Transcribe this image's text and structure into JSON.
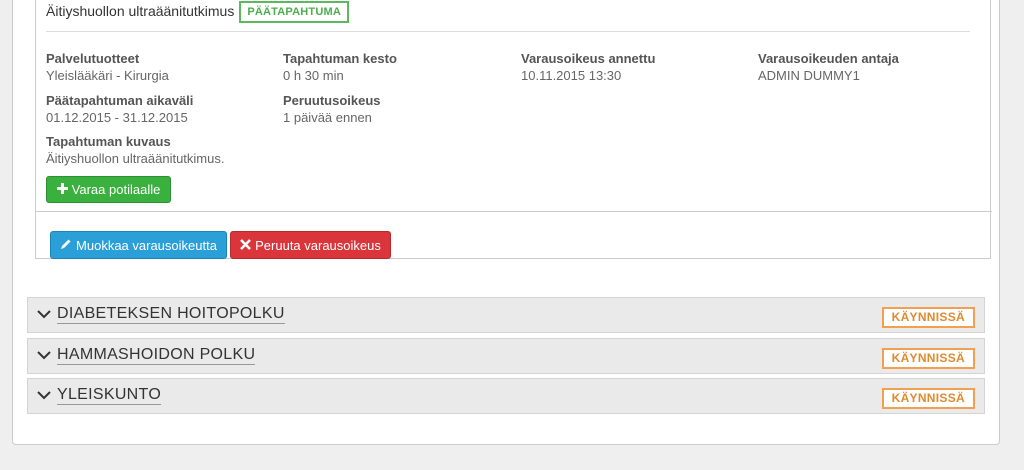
{
  "event": {
    "title": "Äitiyshuollon ultraäänitutkimus",
    "badge": "PÄÄTAPAHTUMA",
    "fields": [
      {
        "label": "Palvelutuotteet",
        "value": "Yleislääkäri - Kirurgia"
      },
      {
        "label": "Tapahtuman kesto",
        "value": "0 h 30 min"
      },
      {
        "label": "Varausoikeus annettu",
        "value": "10.11.2015 13:30"
      },
      {
        "label": "Varausoikeuden antaja",
        "value": "ADMIN DUMMY1"
      },
      {
        "label": "Päätapahtuman aikaväli",
        "value": "01.12.2015 - 31.12.2015"
      },
      {
        "label": "Peruutusoikeus",
        "value": "1 päivää ennen"
      },
      {
        "label": "Tapahtuman kuvaus",
        "value": "Äitiyshuollon ultraäänitutkimus."
      }
    ],
    "book_button": "Varaa potilaalle",
    "edit_button": "Muokkaa varausoikeutta",
    "cancel_button": "Peruuta varausoikeus"
  },
  "paths": [
    {
      "title": "DIABETEKSEN HOITOPOLKU",
      "status": "KÄYNNISSÄ"
    },
    {
      "title": "HAMMASHOIDON POLKU",
      "status": "KÄYNNISSÄ"
    },
    {
      "title": "YLEISKUNTO",
      "status": "KÄYNNISSÄ"
    }
  ],
  "colors": {
    "success": "#3ab03e",
    "primary": "#2a9fd8",
    "danger": "#d9353a",
    "warning": "#f0a050"
  }
}
